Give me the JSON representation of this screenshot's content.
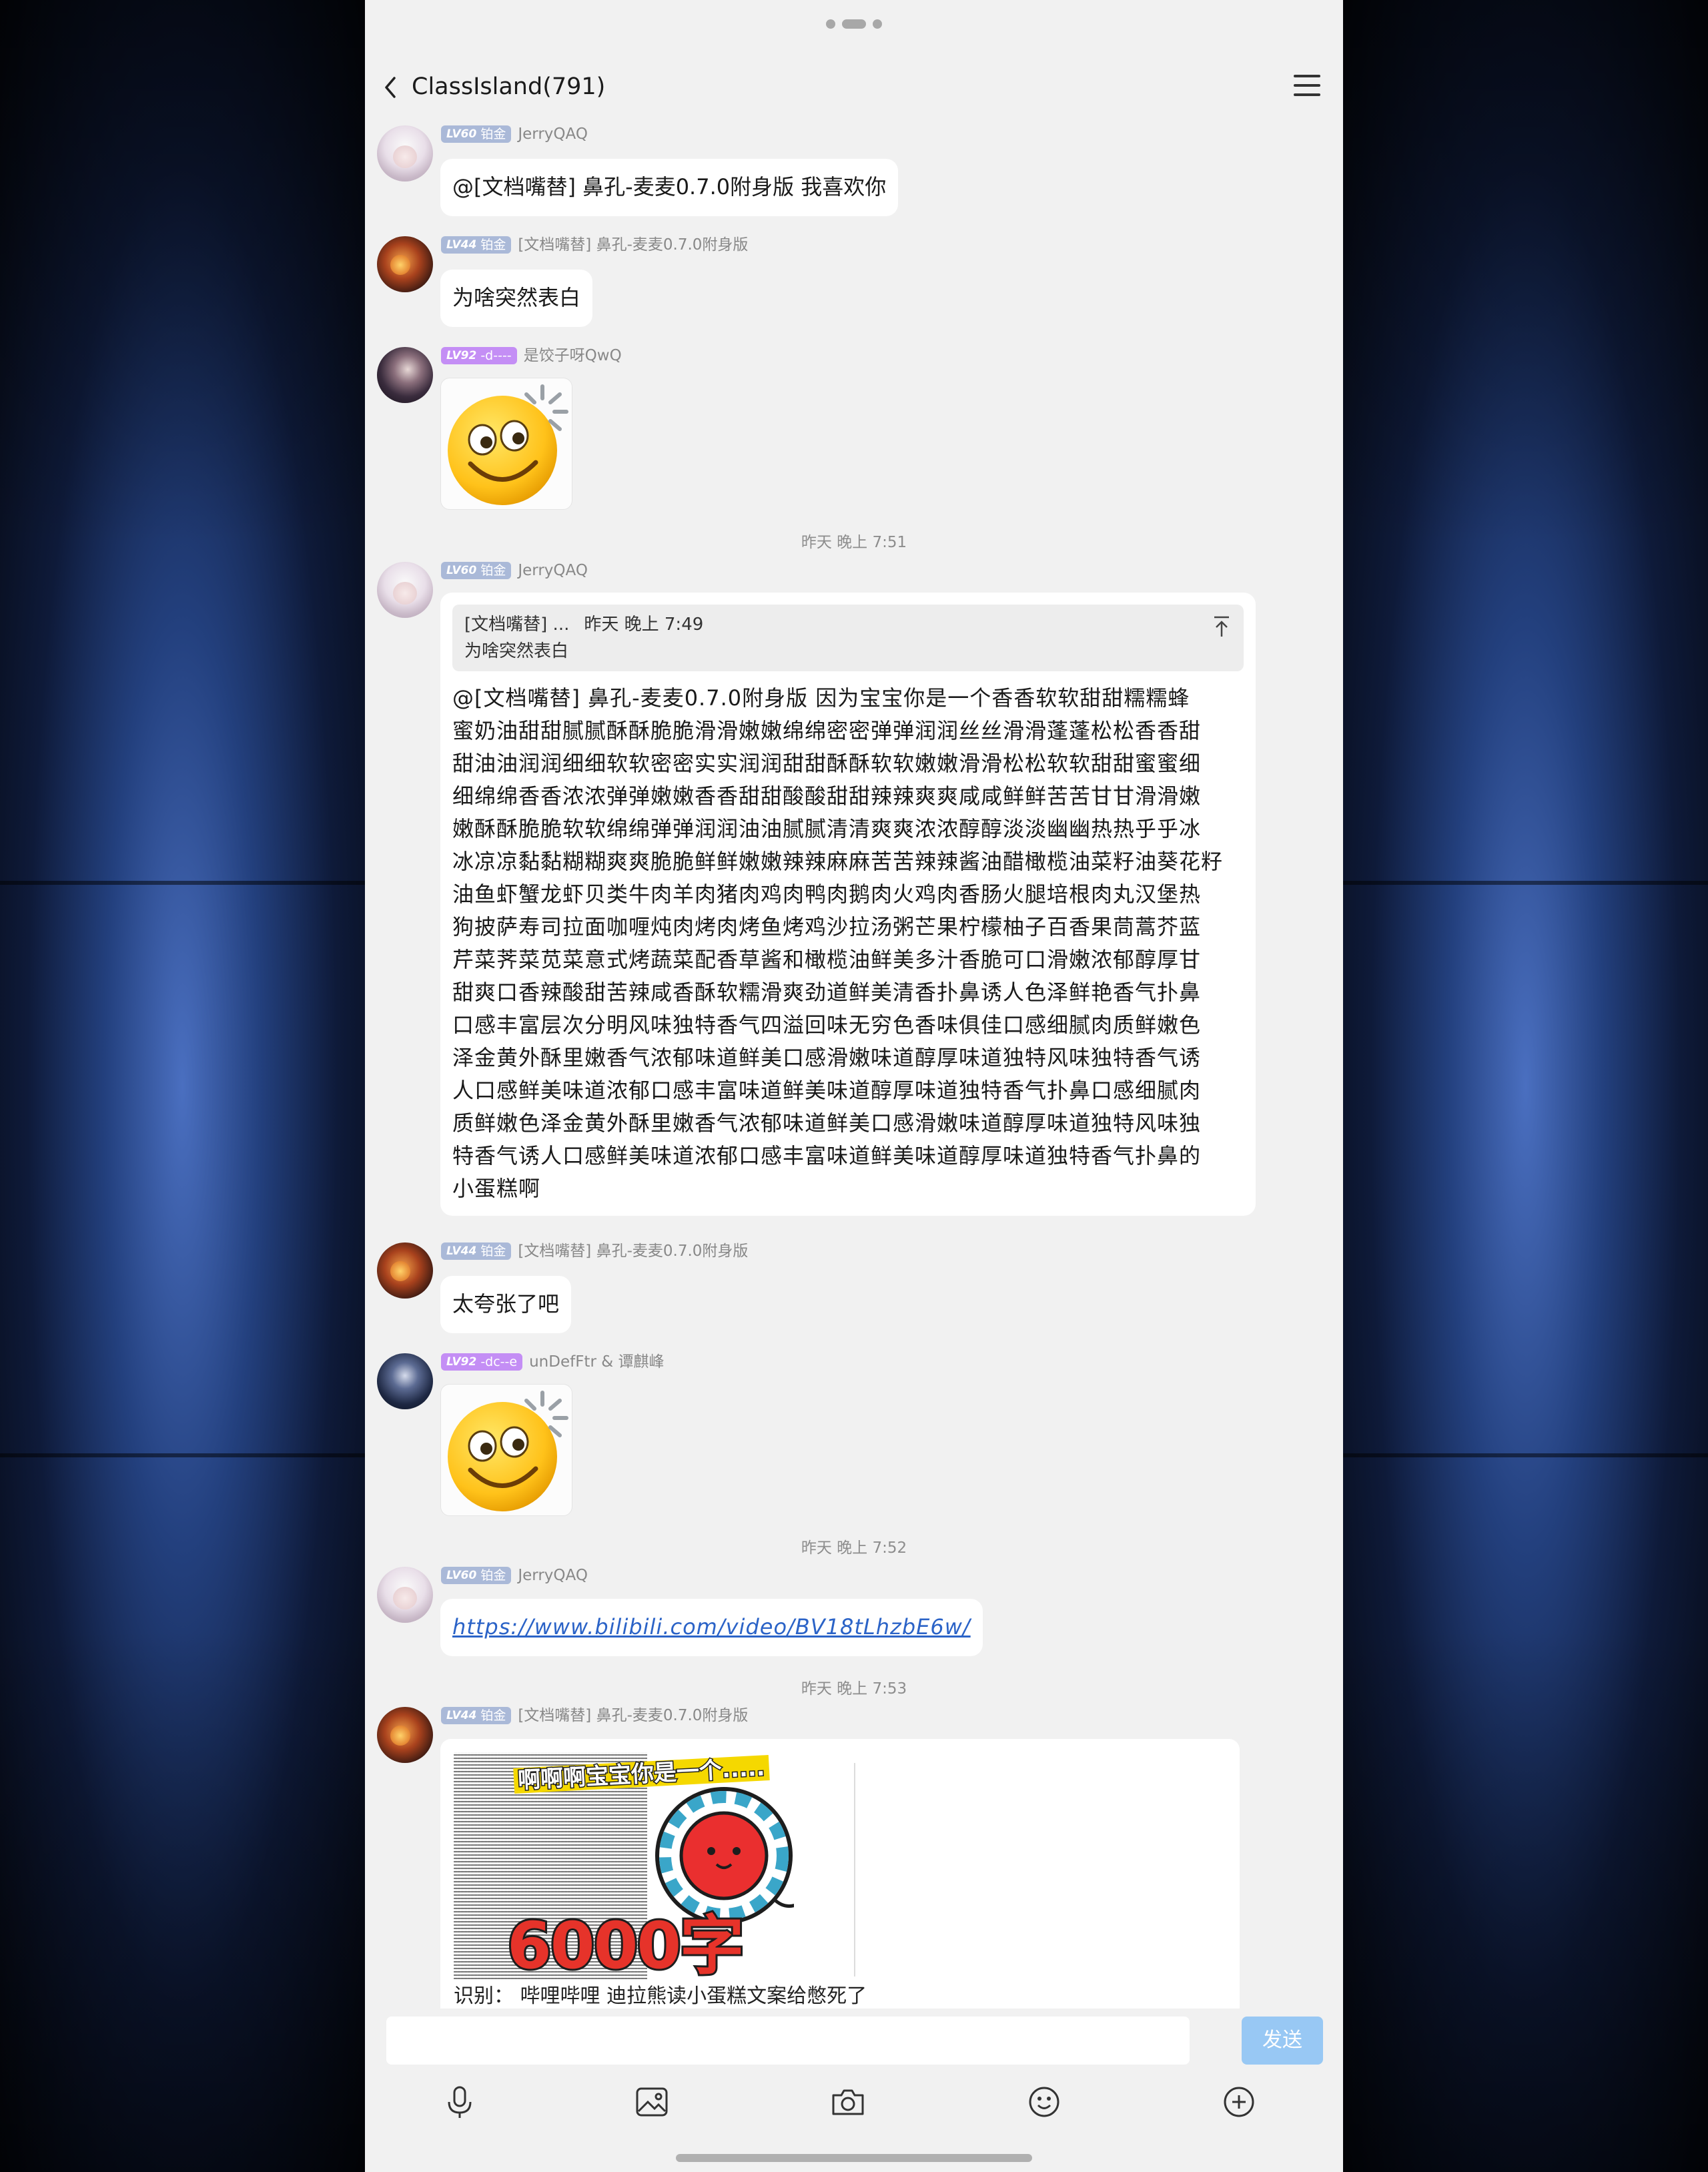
{
  "app": {
    "title": "ClassIsland(791)"
  },
  "messages": [
    {
      "badge": {
        "level": "LV60",
        "tier": "铂金"
      },
      "nick": "JerryQAQ",
      "text": "@[文档嘴替] 鼻孔-麦麦0.7.0附身版 我喜欢你"
    },
    {
      "badge": {
        "level": "LV44",
        "tier": "铂金"
      },
      "nick": "[文档嘴替] 鼻孔-麦麦0.7.0附身版",
      "text": "为啥突然表白"
    },
    {
      "badge": {
        "level": "LV92",
        "tier": "-d----"
      },
      "nick": "是饺子呀QwQ",
      "sticker": "thinking-smiley-sticker"
    },
    {
      "badge": {
        "level": "LV60",
        "tier": "铂金"
      },
      "nick": "JerryQAQ",
      "quote": {
        "author": "[文档嘴替] ...",
        "time": "昨天 晚上 7:49",
        "text": "为啥突然表白"
      },
      "lines": [
        "@[文档嘴替] 鼻孔-麦麦0.7.0附身版 因为宝宝你是一个香香软软甜甜糯糯蜂",
        "蜜奶油甜甜腻腻酥酥脆脆滑滑嫩嫩绵绵密密弹弹润润丝丝滑滑蓬蓬松松香香甜",
        "甜油油润润细细软软密密实实润润甜甜酥酥软软嫩嫩滑滑松松软软甜甜蜜蜜细",
        "细绵绵香香浓浓弹弹嫩嫩香香甜甜酸酸甜甜辣辣爽爽咸咸鲜鲜苦苦甘甘滑滑嫩",
        "嫩酥酥脆脆软软绵绵弹弹润润油油腻腻清清爽爽浓浓醇醇淡淡幽幽热热乎乎冰",
        "冰凉凉黏黏糊糊爽爽脆脆鲜鲜嫩嫩辣辣麻麻苦苦辣辣酱油醋橄榄油菜籽油葵花籽",
        "油鱼虾蟹龙虾贝类牛肉羊肉猪肉鸡肉鸭肉鹅肉火鸡肉香肠火腿培根肉丸汉堡热",
        "狗披萨寿司拉面咖喱炖肉烤肉烤鱼烤鸡沙拉汤粥芒果柠檬柚子百香果茼蒿芥蓝",
        "芹菜荠菜苋菜意式烤蔬菜配香草酱和橄榄油鲜美多汁香脆可口滑嫩浓郁醇厚甘",
        "甜爽口香辣酸甜苦辣咸香酥软糯滑爽劲道鲜美清香扑鼻诱人色泽鲜艳香气扑鼻",
        "口感丰富层次分明风味独特香气四溢回味无穷色香味俱佳口感细腻肉质鲜嫩色",
        "泽金黄外酥里嫩香气浓郁味道鲜美口感滑嫩味道醇厚味道独特风味独特香气诱",
        "人口感鲜美味道浓郁口感丰富味道鲜美味道醇厚味道独特香气扑鼻口感细腻肉",
        "质鲜嫩色泽金黄外酥里嫩香气浓郁味道鲜美口感滑嫩味道醇厚味道独特风味独",
        "特香气诱人口感鲜美味道浓郁口感丰富味道鲜美味道醇厚味道独特香气扑鼻的",
        "小蛋糕啊"
      ]
    },
    {
      "badge": {
        "level": "LV44",
        "tier": "铂金"
      },
      "nick": "[文档嘴替] 鼻孔-麦麦0.7.0附身版",
      "text": "太夸张了吧"
    },
    {
      "badge": {
        "level": "LV92",
        "tier": "-dc--e"
      },
      "nick": "unDefFtr & 谭麒峰",
      "sticker": "thinking-smiley-sticker"
    },
    {
      "badge": {
        "level": "LV60",
        "tier": "铂金"
      },
      "nick": "JerryQAQ",
      "link": "https://www.bilibili.com/video/BV18tLhzbE6w/"
    },
    {
      "badge": {
        "level": "LV44",
        "tier": "铂金"
      },
      "nick": "[文档嘴替] 鼻孔-麦麦0.7.0附身版",
      "image_caption": "啊啊啊宝宝你是一个.....",
      "image_big": "6000字",
      "ocr": "识别： 哔哩哔哩 迪拉熊读小蛋糕文案给憋死了"
    }
  ],
  "timestamps": [
    "昨天 晚上 7:51",
    "昨天 晚上 7:52",
    "昨天 晚上 7:53"
  ],
  "composer": {
    "send_label": "发送",
    "input_value": ""
  },
  "colors": {
    "accent": "#98c8f4",
    "link": "#2b63c7",
    "badge_blue": "#aab9d8",
    "badge_purple": "#c48ef5"
  },
  "toolbar_icons": [
    "microphone-icon",
    "image-icon",
    "camera-icon",
    "emoji-icon",
    "plus-circle-icon"
  ]
}
